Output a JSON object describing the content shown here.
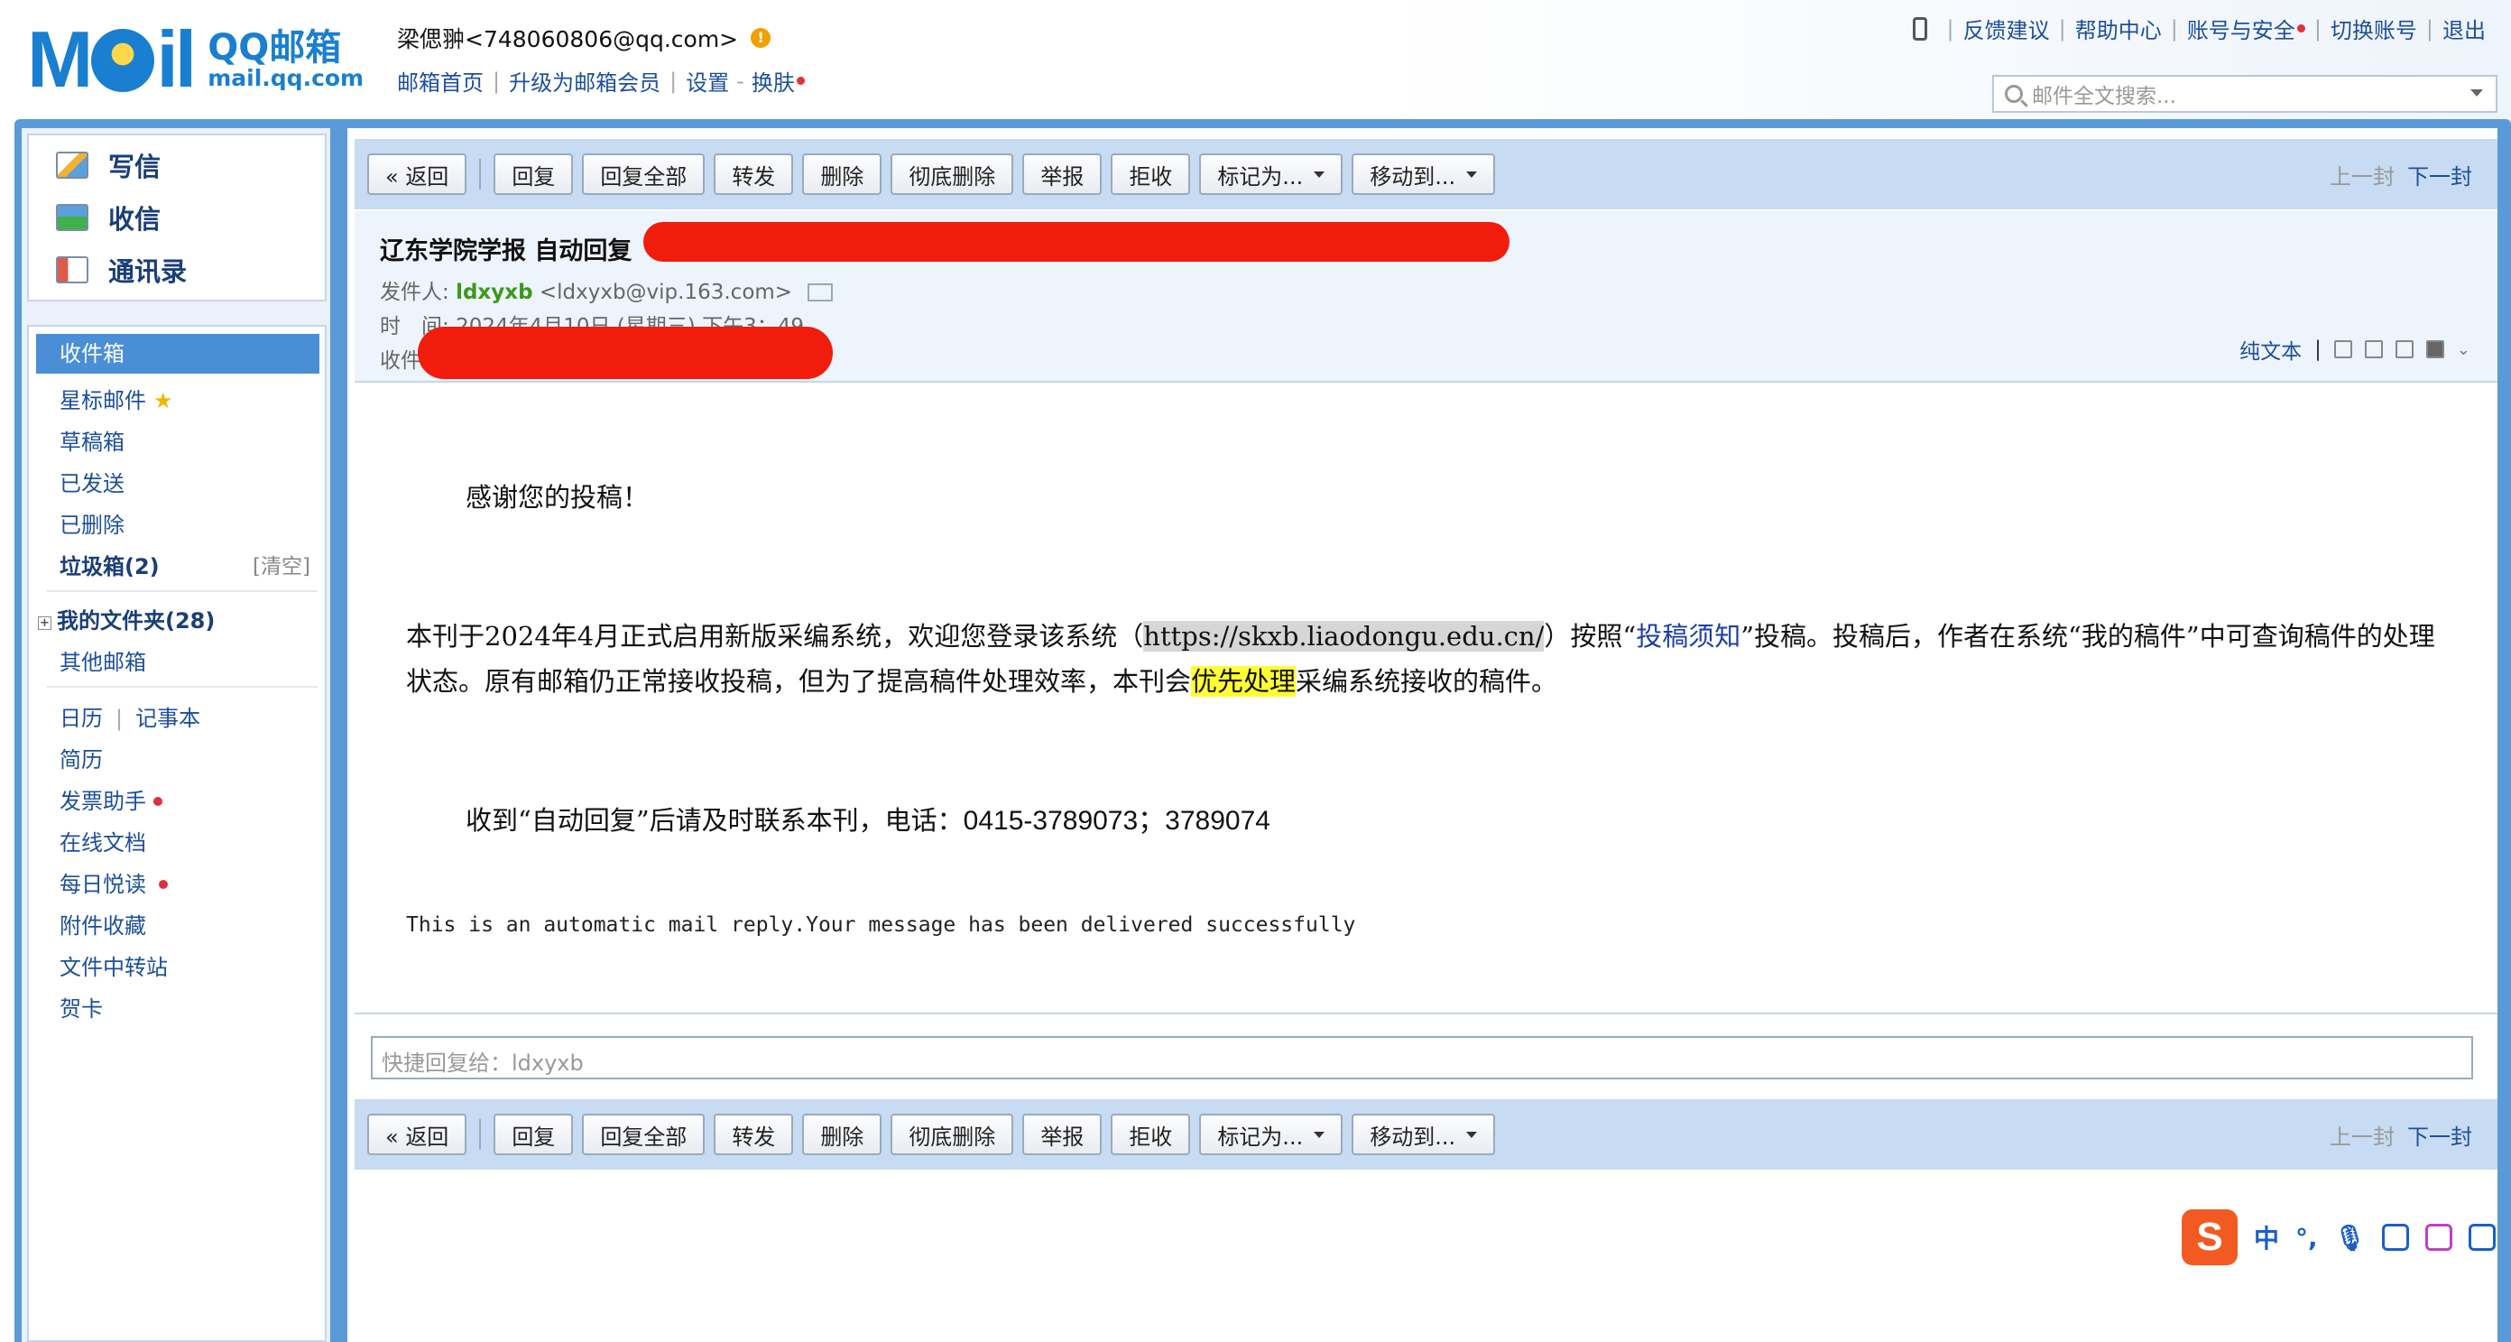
{
  "header": {
    "logo_text": "Mail",
    "logo_brand": "QQ邮箱",
    "logo_url": "mail.qq.com",
    "user": "梁偲翀<748060806@qq.com>",
    "links": [
      "邮箱首页",
      "升级为邮箱会员",
      "设置",
      "换肤"
    ],
    "top_links": [
      "反馈建议",
      "帮助中心",
      "账号与安全",
      "切换账号",
      "退出"
    ],
    "search_placeholder": "邮件全文搜索..."
  },
  "sidebar": {
    "compose": "写信",
    "receive": "收信",
    "contacts": "通讯录",
    "folders": {
      "inbox": "收件箱",
      "starred": "星标邮件",
      "drafts": "草稿箱",
      "sent": "已发送",
      "deleted": "已删除",
      "junk": "垃圾箱(2)",
      "clear": "[清空]",
      "my_folders": "我的文件夹(28)",
      "other": "其他邮箱",
      "calendar": "日历",
      "notes": "记事本",
      "resume": "简历",
      "invoice": "发票助手",
      "docs": "在线文档",
      "daily": "每日悦读",
      "attachments": "附件收藏",
      "transfer": "文件中转站",
      "cards": "贺卡"
    }
  },
  "toolbar": {
    "back": "« 返回",
    "reply": "回复",
    "reply_all": "回复全部",
    "forward": "转发",
    "delete": "删除",
    "delete_perm": "彻底删除",
    "report": "举报",
    "reject": "拒收",
    "mark_as": "标记为...",
    "move_to": "移动到...",
    "prev": "上一封",
    "next": "下一封"
  },
  "mail": {
    "subject": "辽东学院学报 自动回复",
    "from_label": "发件人:",
    "from_name": "ldxyxb",
    "from_email": "<ldxyxb@vip.163.com>",
    "time_label": "时　间:",
    "time": "2024年4月10日 (星期三) 下午3：49",
    "to_label": "收件人:",
    "plain_text": "纯文本",
    "greeting": "感谢您的投稿！",
    "p1_a": "本刊于2024年4月正式启用新版采编系统，欢迎您登录该系统（",
    "p1_url": "https://skxb.liaodongu.edu.cn/",
    "p1_b": "）按照“",
    "p1_link": "投稿须知",
    "p1_c": "”投稿。投稿后，作者在系统“我的稿件”中可查询稿件的处理状态。原有邮箱仍正常接收投稿，但为了提高稿件处理效率，本刊会",
    "p1_hl": "优先处理",
    "p1_d": "采编系统接收的稿件。",
    "p2_a": "收到“自动回复”后请及时联系本刊，电话：",
    "p2_phone": "0415-3789073；3789074",
    "p3": "This is an automatic mail reply.Your message has been delivered successfully",
    "quick_reply": "快捷回复给：ldxyxb"
  },
  "ime": {
    "logo": "S",
    "lang": "中",
    "punct": "°,"
  }
}
